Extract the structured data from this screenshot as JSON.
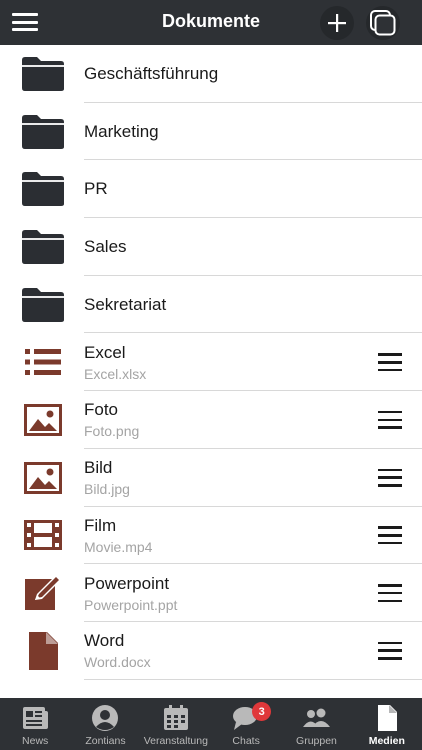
{
  "header": {
    "title": "Dokumente",
    "menu_icon": "hamburger-icon",
    "add_icon": "plus-icon",
    "copy_icon": "copy-icon"
  },
  "colors": {
    "bar": "#2e3135",
    "folder": "#2b2e33",
    "file_icon": "#7b3a2c",
    "badge": "#e0383a"
  },
  "folders": [
    {
      "name": "Geschäftsführung"
    },
    {
      "name": "Marketing"
    },
    {
      "name": "PR"
    },
    {
      "name": "Sales"
    },
    {
      "name": "Sekretariat"
    }
  ],
  "files": [
    {
      "name": "Excel",
      "file": "Excel.xlsx",
      "icon": "list-icon"
    },
    {
      "name": "Foto",
      "file": "Foto.png",
      "icon": "image-icon"
    },
    {
      "name": "Bild",
      "file": "Bild.jpg",
      "icon": "image-icon"
    },
    {
      "name": "Film",
      "file": "Movie.mp4",
      "icon": "film-icon"
    },
    {
      "name": "Powerpoint",
      "file": "Powerpoint.ppt",
      "icon": "edit-icon"
    },
    {
      "name": "Word",
      "file": "Word.docx",
      "icon": "document-icon"
    }
  ],
  "tabs": [
    {
      "label": "News",
      "icon": "newspaper-icon"
    },
    {
      "label": "Zontians",
      "icon": "person-icon"
    },
    {
      "label": "Veranstaltung",
      "icon": "calendar-icon"
    },
    {
      "label": "Chats",
      "icon": "chat-icon",
      "badge": "3"
    },
    {
      "label": "Gruppen",
      "icon": "group-icon"
    },
    {
      "label": "Medien",
      "icon": "file-icon",
      "active": true
    }
  ]
}
